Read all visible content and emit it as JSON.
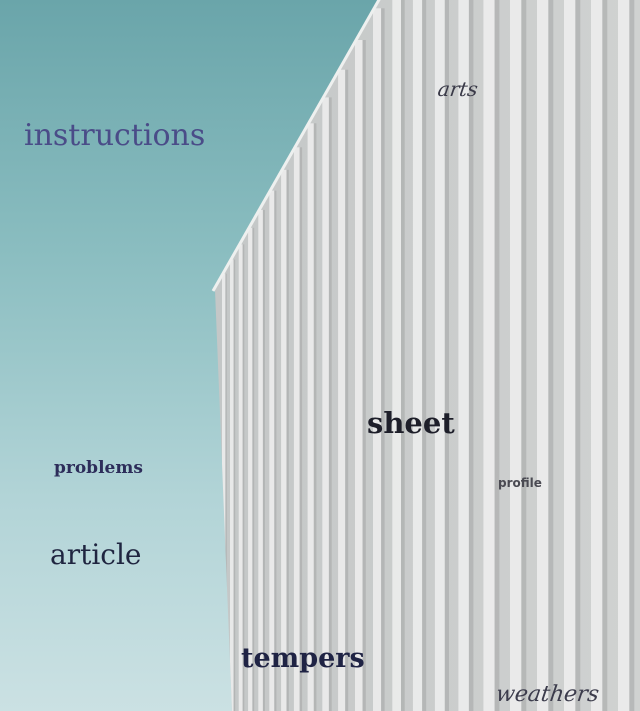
{
  "image": {
    "subject": "concrete building facade with vertical fins against a teal sky",
    "colors": {
      "sky_top": "#6aa5aa",
      "sky_bottom": "#cbe1e3",
      "concrete": "#c9cbcb",
      "fin_highlight": "#eeefee",
      "fin_shadow": "#a6a9a9"
    }
  },
  "words": {
    "instructions": "instructions",
    "arts": "arts",
    "sheet": "sheet",
    "problems": "problems",
    "profile": "profile",
    "article": "article",
    "tempers": "tempers",
    "weathers": "weathers"
  }
}
